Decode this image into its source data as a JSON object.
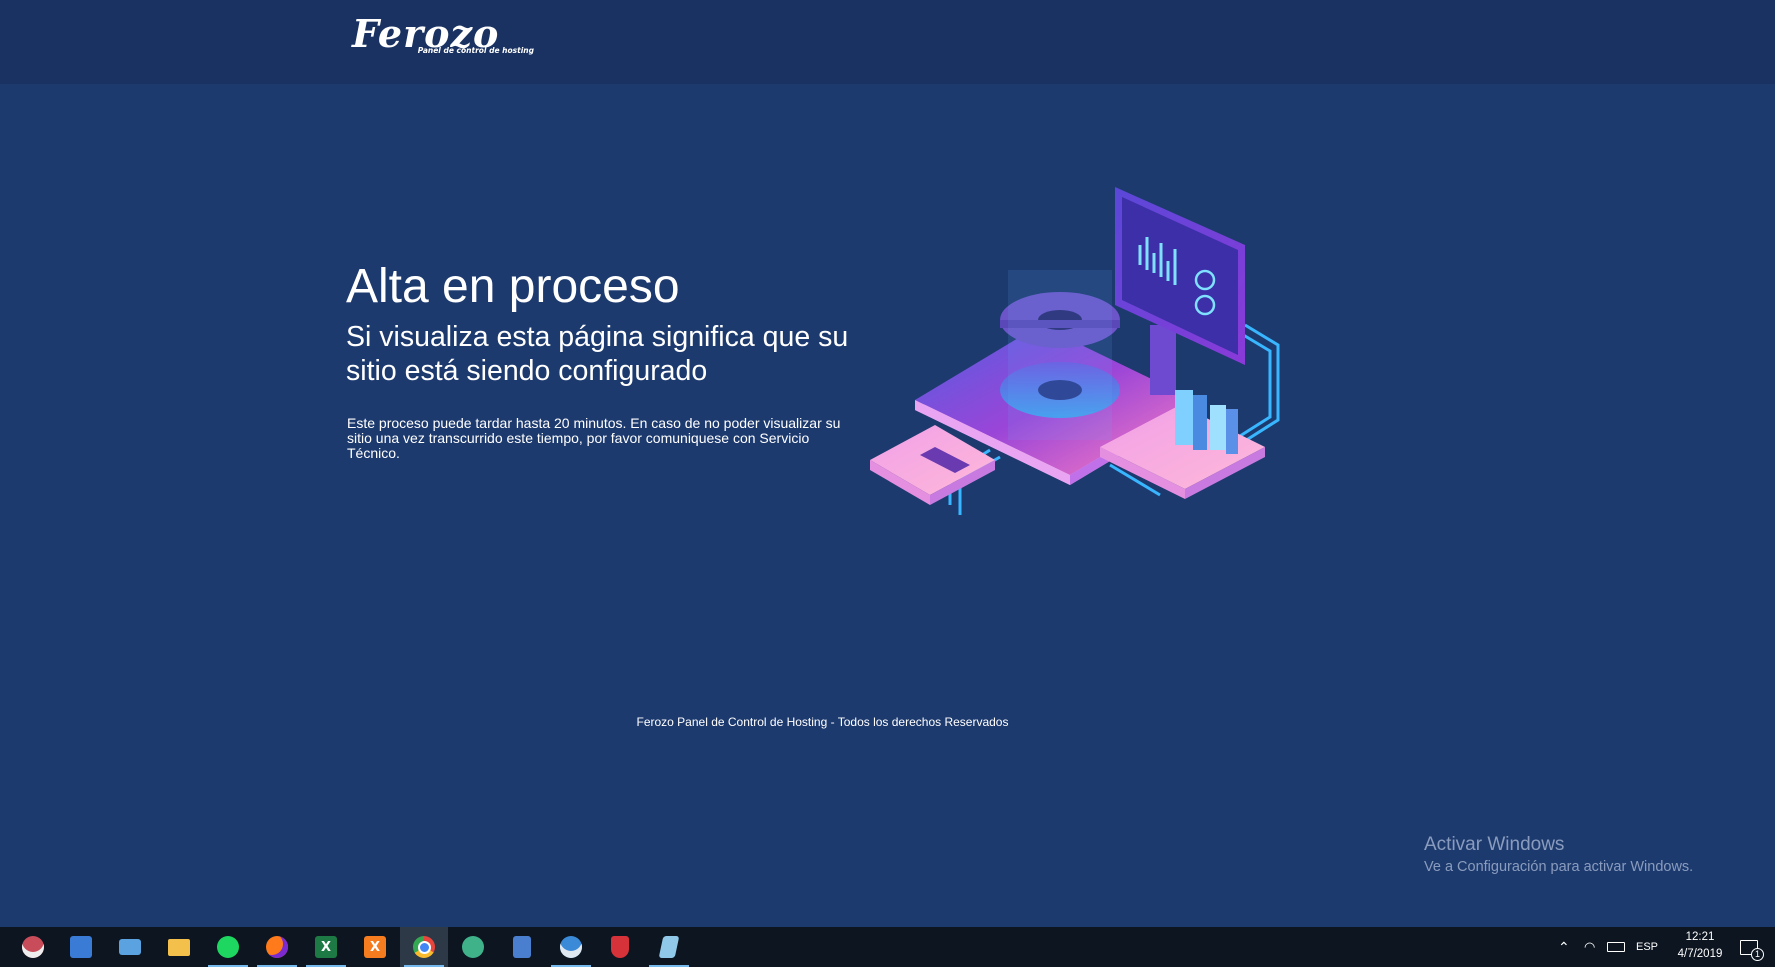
{
  "brand": {
    "name": "Ferozo",
    "tagline": "Panel de control de hosting"
  },
  "main": {
    "title": "Alta en proceso",
    "subtitle": "Si visualiza esta página significa que su sitio está siendo configurado",
    "description": "Este proceso puede tardar hasta 20 minutos. En caso de no poder visualizar su sitio una vez transcurrido este tiempo, por favor comuniquese con Servicio Técnico."
  },
  "footer": {
    "text": "Ferozo Panel de Control de Hosting - Todos los derechos Reservados"
  },
  "watermark": {
    "title": "Activar Windows",
    "subtitle": "Ve a Configuración para activar Windows."
  },
  "taskbar": {
    "apps": [
      {
        "name": "network-tool-icon",
        "color": "#c94c5a"
      },
      {
        "name": "computer-icon",
        "color": "#3a7bd5"
      },
      {
        "name": "display-settings-icon",
        "color": "#5aa3e0"
      },
      {
        "name": "file-explorer-icon",
        "color": "#f2c04b"
      },
      {
        "name": "spotify-icon",
        "color": "#1ed760"
      },
      {
        "name": "firefox-icon",
        "color": "#ff7a1a"
      },
      {
        "name": "excel-icon",
        "color": "#1d7a45"
      },
      {
        "name": "xampp-icon",
        "color": "#f57c1f"
      },
      {
        "name": "chrome-icon",
        "color": "#e8453c"
      },
      {
        "name": "atom-icon",
        "color": "#3fb28a"
      },
      {
        "name": "network-share-icon",
        "color": "#4a7fd0"
      },
      {
        "name": "thunderbird-icon",
        "color": "#3a8ad8"
      },
      {
        "name": "shield-app-icon",
        "color": "#d6323a"
      },
      {
        "name": "notepad-icon",
        "color": "#8fc8e8"
      }
    ],
    "language": "ESP",
    "time": "12:21",
    "date": "4/7/2019",
    "notification_count": "1"
  }
}
